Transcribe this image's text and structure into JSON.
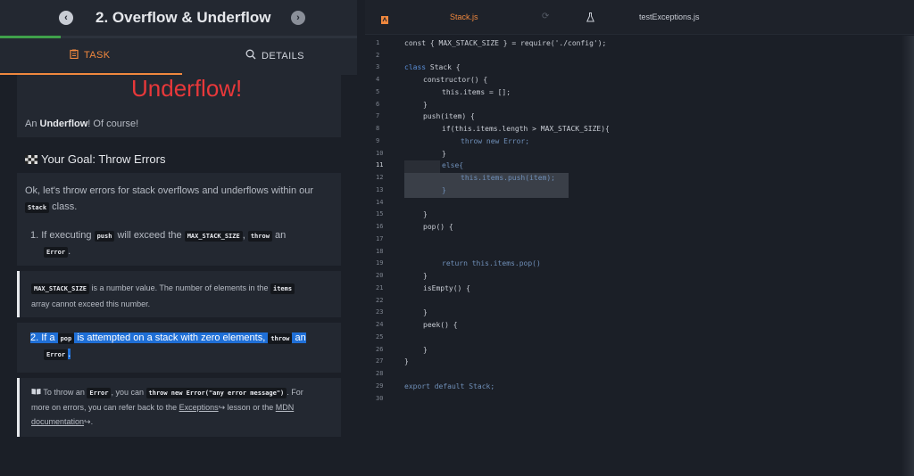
{
  "header": {
    "title": "2. Overflow & Underflow",
    "progress_fraction": 0.17
  },
  "tabs": {
    "task": "TASK",
    "details": "DETAILS"
  },
  "lesson": {
    "underflow_heading": "Underflow!",
    "intro_prefix": "An ",
    "intro_bold": "Underflow",
    "intro_suffix": "! Of course!",
    "goal": "Your Goal: Throw Errors",
    "goal_icon": "checkered-flag-icon",
    "desc_line1": "Ok, let's throw errors for stack overflows and underflows within our",
    "desc_code": "Stack",
    "desc_suffix": "class.",
    "step1_prefix": "1. If executing",
    "step1_code1": "push",
    "step1_mid": "will exceed the",
    "step1_code2": "MAX_STACK_SIZE",
    "step1_comma": ",",
    "step1_code3": "throw",
    "step1_an": "an",
    "step1_code4": "Error",
    "step1_end": ".",
    "note1_code": "MAX_STACK_SIZE",
    "note1_text1": "is a number value. The number of elements in the",
    "note1_code2": "items",
    "note1_text2": "array cannot exceed this number.",
    "step2_prefix": "2. If a",
    "step2_code1": "pop",
    "step2_mid": "is attempted on a stack with zero elements,",
    "step2_code2": "throw",
    "step2_an": "an",
    "step2_code3": "Error",
    "step2_end": ".",
    "note2_prefix": "To throw an",
    "note2_code1": "Error",
    "note2_mid": ", you can",
    "note2_code2": "throw new Error(\"any error message\")",
    "note2_for": ". For",
    "note2_line2_prefix": "more on errors, you can refer back to the",
    "note2_link1": "Exceptions",
    "note2_line2_mid": "lesson or the",
    "note2_link2": "MDN",
    "note2_link3": "documentation",
    "note2_end": ".",
    "note2_icon": "book-icon"
  },
  "editor": {
    "tabs": [
      "Stack.js",
      "testExceptions.js"
    ],
    "active_tab": "Stack.js",
    "line_numbers": [
      "1",
      "2",
      "3",
      "4",
      "5",
      "6",
      "7",
      "8",
      "9",
      "10",
      "11",
      "12",
      "13",
      "14",
      "15",
      "16",
      "17",
      "18",
      "19",
      "20",
      "21",
      "22",
      "23",
      "24",
      "25",
      "26",
      "27",
      "28",
      "29",
      "30"
    ],
    "code": {
      "l1": "const { MAX_STACK_SIZE } = require('./config');",
      "l3a": "class",
      "l3b": " Stack {",
      "l4": "constructor() {",
      "l5": "this.items = [];",
      "l6": "}",
      "l7": "push(item) {",
      "l8": "if(this.items.length > MAX_STACK_SIZE){",
      "l9": "throw new Error;",
      "l10": "}",
      "l11": "else{",
      "l12": "this.items.push(item);",
      "l13": "}",
      "l15": "}",
      "l16": "pop() {",
      "l19": "return this.items.pop()",
      "l20": "}",
      "l21": "isEmpty() {",
      "l23": "}",
      "l24": "peek() {",
      "l26": "}",
      "l27": "}",
      "l29": "export default Stack;"
    }
  },
  "colors": {
    "accent": "#f0883e",
    "error_heading": "#e8383a",
    "selection": "#1f6fd6",
    "progress": "#3fa14a"
  }
}
